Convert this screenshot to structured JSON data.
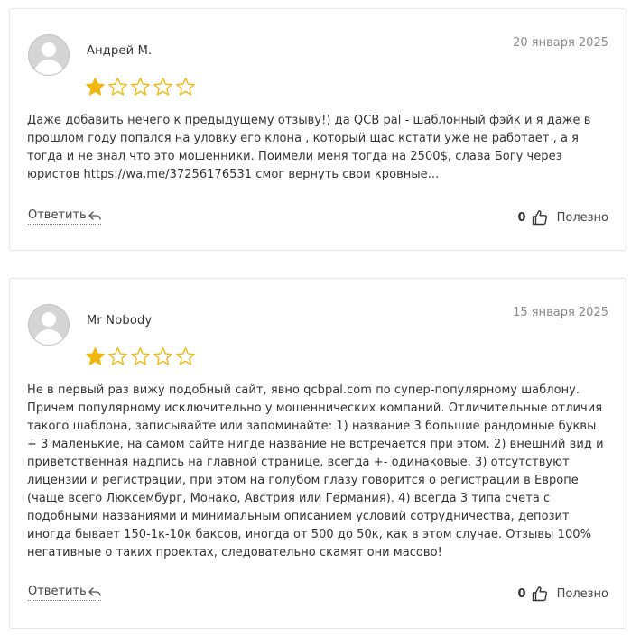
{
  "colors": {
    "star_filled": "#f2b70f",
    "star_empty": "#f2b70f",
    "border": "#e6e6e6",
    "date": "#888888"
  },
  "reviews": [
    {
      "author": "Андрей М.",
      "date": "20 января 2025",
      "rating": 1,
      "rating_max": 5,
      "text": "Даже добавить нечего к предыдущему отзыву!) да QCB pal - шаблонный фэйк и я даже в прошлом году попался на уловку его клона , который щас кстати уже не работает , а я тогда и не знал что это мошенники. Поимели меня тогда на 2500$, слава Богу через юристов https://wa.me/37256176531 смог вернуть свои кровные...",
      "reply_label": "Ответить",
      "useful_count": "0",
      "useful_label": "Полезно"
    },
    {
      "author": "Mr Nobody",
      "date": "15 января 2025",
      "rating": 1,
      "rating_max": 5,
      "text": "Не в первый раз вижу подобный сайт, явно qcbpal.com по супер-популярному шаблону. Причем популярному исключительно у мошеннических компаний. Отличительные отличия такого шаблона, записывайте или запоминайте: 1) название 3 большие рандомные буквы + 3 маленькие, на самом сайте нигде название не встречается при этом. 2) внешний вид и приветственная надпись на главной странице, всегда +- одинаковые. 3) отсутствуют лицензии и регистрации, при этом на голубом глазу говорится о регистрации в Европе (чаще всего Люксембург, Монако, Австрия или Германия). 4) всегда 3 типа счета с подобными названиями и минимальным описанием условий сотрудничества, депозит иногда бывает 150-1к-10к баксов, иногда от 500 до 50к, как в этом случае. Отзывы 100% негативные о таких проектах, следовательно скамят они масово!",
      "reply_label": "Ответить",
      "useful_count": "0",
      "useful_label": "Полезно"
    }
  ]
}
